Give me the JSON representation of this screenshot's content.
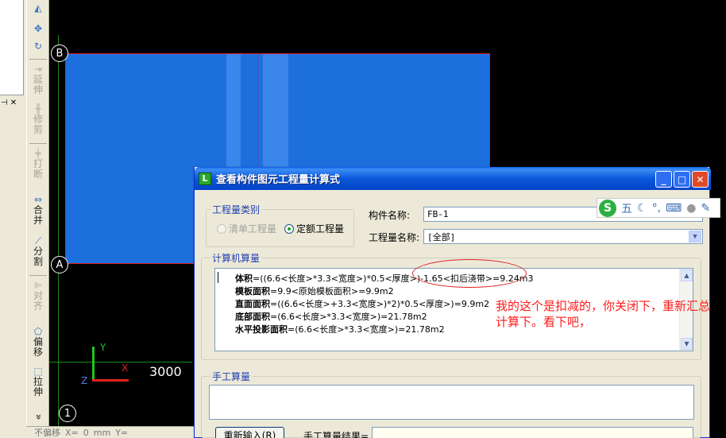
{
  "toolbar": {
    "items": [
      {
        "label": "延伸",
        "enabled": false
      },
      {
        "label": "修剪",
        "enabled": false
      },
      {
        "label": "打断",
        "enabled": false
      },
      {
        "label": "合并",
        "enabled": true
      },
      {
        "label": "分割",
        "enabled": true
      },
      {
        "label": "对齐",
        "enabled": false
      },
      {
        "label": "偏移",
        "enabled": true
      },
      {
        "label": "拉伸",
        "enabled": true
      }
    ],
    "more_glyph": "»"
  },
  "canvas": {
    "axis_labels": [
      "B",
      "A",
      "1"
    ],
    "dimension": "3000",
    "ucs": {
      "y": "Y",
      "x": "X",
      "z": "Z"
    }
  },
  "statusbar": {
    "mode": "不偏移",
    "x_label": "X=",
    "x_value": "0",
    "unit": "mm",
    "y_label": "Y="
  },
  "dialog": {
    "title": "查看构件图元工程量计算式",
    "qty_type": {
      "label": "工程量类别",
      "options": [
        {
          "label": "清单工程量",
          "selected": false,
          "enabled": false
        },
        {
          "label": "定额工程量",
          "selected": true,
          "enabled": true
        }
      ]
    },
    "component_name_label": "构件名称:",
    "component_name_value": "FB-1",
    "qty_name_label": "工程量名称:",
    "qty_name_value": "[全部]",
    "calc_group_label": "计算机算量",
    "calc_lines": [
      {
        "name": "体积",
        "expr": "=((6.6<长度>*3.3<宽度>)*0.5<厚度>)-1.65<扣后浇带>=9.24m3"
      },
      {
        "name": "模板面积",
        "expr": "=9.9<原始模板面积>=9.9m2"
      },
      {
        "name": "直面面积",
        "expr": "=((6.6<长度>+3.3<宽度>)*2)*0.5<厚度>)=9.9m2"
      },
      {
        "name": "底部面积",
        "expr": "=(6.6<长度>*3.3<宽度>)=21.78m2"
      },
      {
        "name": "水平投影面积",
        "expr": "=(6.6<长度>*3.3<宽度>)=21.78m2"
      }
    ],
    "manual_group_label": "手工算量",
    "reinput_button": "重新输入(R)",
    "manual_result_label": "手工算量结果="
  },
  "annotation": {
    "text_line1": "我的这个是扣减的，你关闭下，重新汇总",
    "text_line2": "计算下。看下吧，",
    "color": "#ff1a1a"
  },
  "ime": {
    "logo": "S",
    "mode": "五"
  },
  "colors": {
    "slab": "#1e6fde",
    "grid_line": "#e02020",
    "titlebar": "#0b58db"
  }
}
